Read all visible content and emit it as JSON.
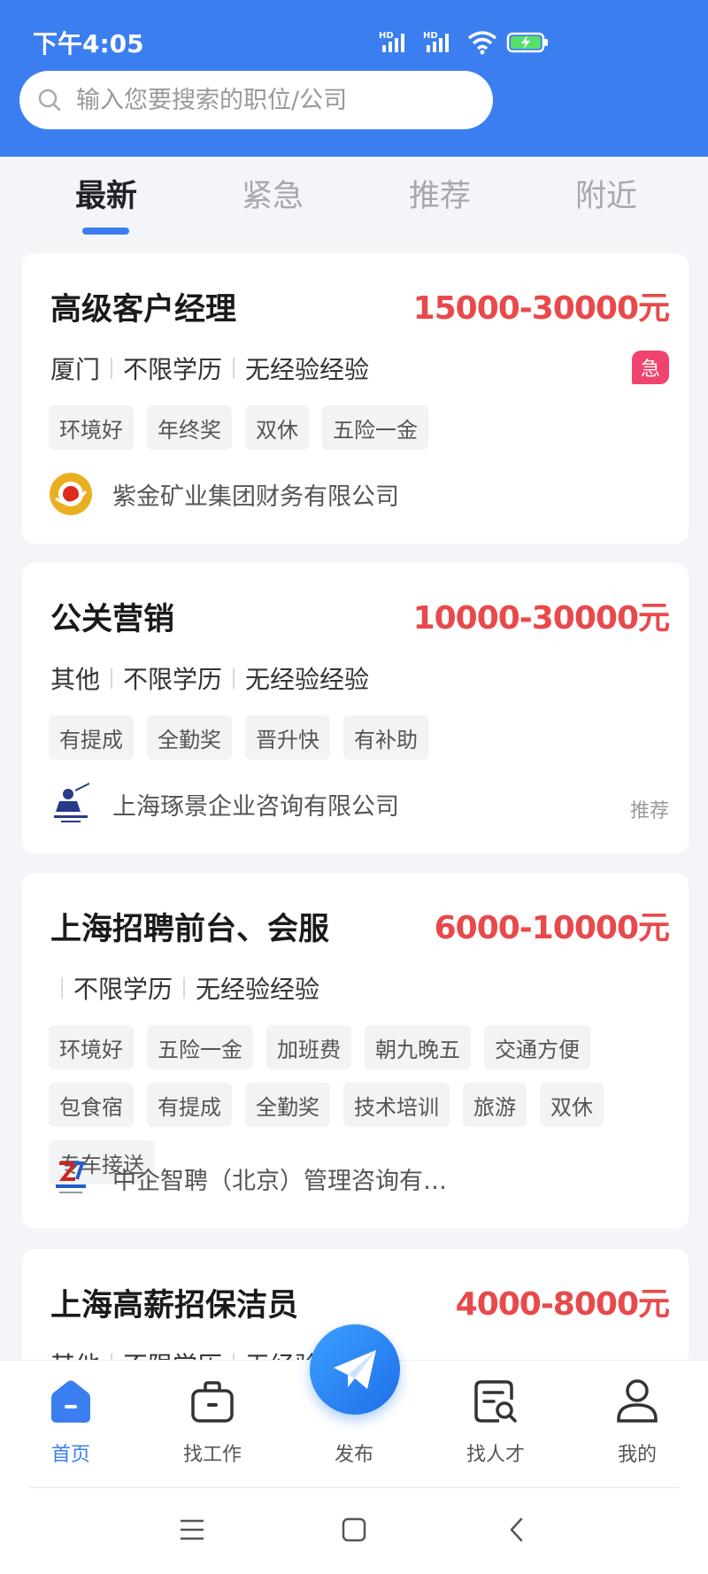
{
  "status_bar": {
    "time": "下午4:05",
    "hd1": "HD",
    "hd2": "HD"
  },
  "search": {
    "placeholder": "输入您要搜索的职位/公司"
  },
  "tabs": [
    {
      "label": "最新",
      "active": true
    },
    {
      "label": "紧急",
      "active": false
    },
    {
      "label": "推荐",
      "active": false
    },
    {
      "label": "附近",
      "active": false
    }
  ],
  "jobs": [
    {
      "title": "高级客户经理",
      "salary": "15000-30000元",
      "location": "厦门",
      "education": "不限学历",
      "experience": "无经验经验",
      "tags": [
        "环境好",
        "年终奖",
        "双休",
        "五险一金"
      ],
      "company": "紫金矿业集团财务有限公司",
      "badge": "急"
    },
    {
      "title": "公关营销",
      "salary": "10000-30000元",
      "location": "其他",
      "education": "不限学历",
      "experience": "无经验经验",
      "tags": [
        "有提成",
        "全勤奖",
        "晋升快",
        "有补助"
      ],
      "company": "上海琢景企业咨询有限公司",
      "label": "推荐"
    },
    {
      "title": "上海招聘前台、会服",
      "salary": "6000-10000元",
      "location": "",
      "education": "不限学历",
      "experience": "无经验经验",
      "tags": [
        "环境好",
        "五险一金",
        "加班费",
        "朝九晚五",
        "交通方便",
        "包食宿",
        "有提成",
        "全勤奖",
        "技术培训",
        "旅游",
        "双休",
        "专车接送"
      ],
      "company": "中企智聘（北京）管理咨询有…"
    },
    {
      "title": "上海高薪招保洁员",
      "salary": "4000-8000元",
      "location": "其他",
      "education": "不限学历",
      "experience": "无经验"
    }
  ],
  "bottom_nav": [
    {
      "label": "首页",
      "icon": "home-icon",
      "active": true
    },
    {
      "label": "找工作",
      "icon": "briefcase-icon",
      "active": false
    },
    {
      "label": "发布",
      "icon": "paper-plane-icon",
      "active": false
    },
    {
      "label": "找人才",
      "icon": "talent-search-icon",
      "active": false
    },
    {
      "label": "我的",
      "icon": "profile-icon",
      "active": false
    }
  ],
  "colors": {
    "brand_blue": "#3b7ef0",
    "salary_red": "#e8494b",
    "urgent_pink": "#f0446e"
  }
}
